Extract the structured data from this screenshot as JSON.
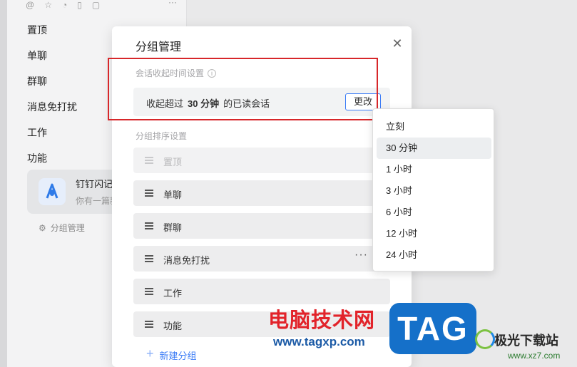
{
  "sidebar": {
    "more": "···",
    "items": [
      "置顶",
      "单聊",
      "群聊",
      "消息免打扰",
      "工作",
      "功能"
    ],
    "card": {
      "name": "钉钉闪记助",
      "subtitle": "你有一篇新"
    },
    "manage_label": "分组管理"
  },
  "modal": {
    "title": "分组管理",
    "collapse_section_label": "会话收起时间设置",
    "collapse_prefix": "收起超过",
    "collapse_value": "30 分钟",
    "collapse_suffix": "的已读会话",
    "change_button": "更改",
    "sort_section_label": "分组排序设置",
    "groups": [
      "置顶",
      "单聊",
      "群聊",
      "消息免打扰",
      "工作",
      "功能"
    ],
    "row_more": "···",
    "new_group": "新建分组"
  },
  "dropdown": {
    "options": [
      "立刻",
      "30 分钟",
      "1 小时",
      "3 小时",
      "6 小时",
      "12 小时",
      "24 小时"
    ],
    "selected": "30 分钟"
  },
  "watermark": {
    "title": "电脑技术网",
    "url": "www.tagxp.com",
    "tag": "TAG",
    "brand": "极光下载站",
    "brand_url": "www.xz7.com"
  },
  "colors": {
    "accent": "#3b7cf6",
    "highlight": "#d7272a"
  }
}
